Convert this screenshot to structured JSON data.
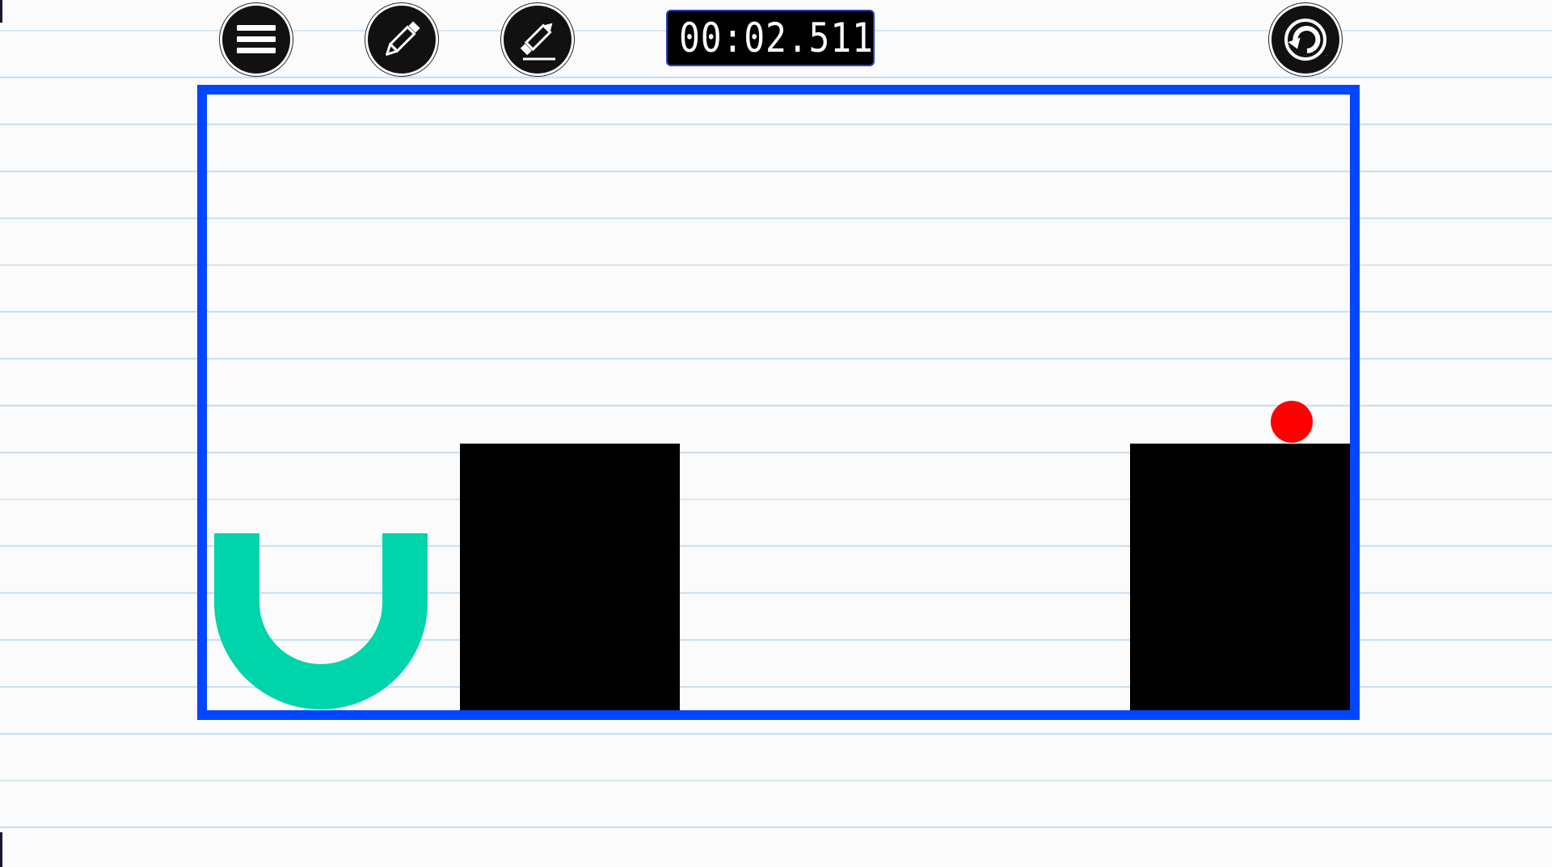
{
  "toolbar": {
    "menu_icon": "hamburger-menu-icon",
    "draw_icon": "pencil-icon",
    "erase_icon": "pencil-eraser-icon",
    "restart_icon": "restart-icon"
  },
  "timer": {
    "value": "00:02.511"
  },
  "colors": {
    "frame": "#0046ff",
    "obstacle": "#000000",
    "ball": "#ff0000",
    "cup": "#00d4aa",
    "paper_line": "#c9def0"
  }
}
